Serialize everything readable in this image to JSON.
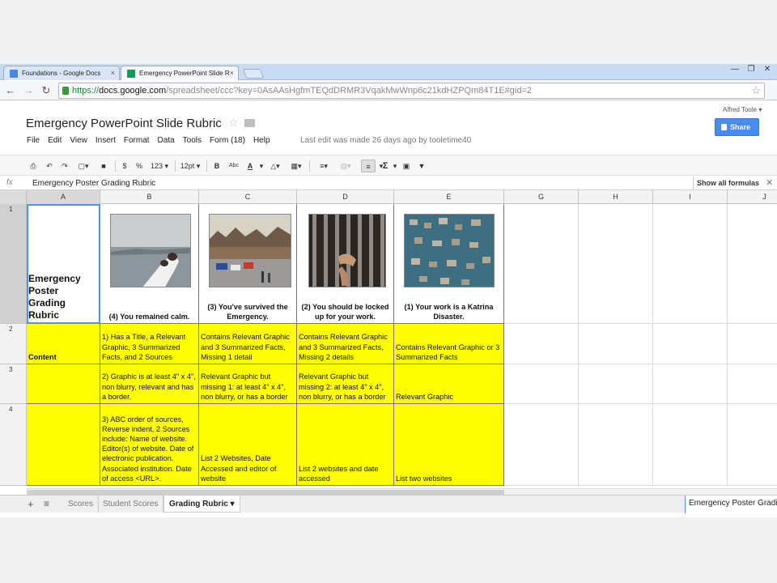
{
  "browser": {
    "tabs": [
      {
        "title": "Foundations - Google Docs",
        "close": "×",
        "icon_color": "#4a86e8"
      },
      {
        "title": "Emergency PowerPoint Slide R",
        "close": "×",
        "icon_color": "#0f9d58"
      }
    ],
    "url": {
      "scheme": "https://",
      "host": "docs.google.com",
      "path": "/spreadsheet/ccc?key=0AsAAsHgfmTEQdDRMR3VqakMwWnp6c21kdHZPQm84T1E#gid=2"
    },
    "window_controls": {
      "minimize": "—",
      "restore": "❐",
      "close": "✕"
    }
  },
  "doc": {
    "title": "Emergency PowerPoint Slide Rubric",
    "user": "Alfred Toole ▾",
    "share_label": "Share",
    "menu": [
      "File",
      "Edit",
      "View",
      "Insert",
      "Format",
      "Data",
      "Tools",
      "Form (18)",
      "Help"
    ],
    "last_edit": "Last edit was made 26 days ago by tooletime40"
  },
  "toolbar": {
    "currency": "$",
    "percent": "%",
    "number_format": "123 ▾",
    "font_size": "12pt ▾",
    "bold": "B",
    "strikethrough": "Abc",
    "text_color": "A",
    "sum": "Σ"
  },
  "formula_bar": {
    "fx": "fx",
    "content": "Emergency Poster Grading Rubric",
    "show_formulas": "Show all formulas",
    "close": "✕"
  },
  "grid": {
    "columns": [
      "A",
      "B",
      "C",
      "D",
      "E",
      "G",
      "H",
      "I",
      "J"
    ],
    "rows": [
      "1",
      "2",
      "3",
      "4"
    ],
    "header": {
      "a1": "Emergency Poster Grading Rubric",
      "b1": "(4) You remained calm.",
      "c1": "(3) You've survived the Emergency.",
      "d1": "(2) You should be locked up for your work.",
      "e1": "(1) Your work is a Katrina Disaster."
    },
    "row2": {
      "a": "Content",
      "b": "1) Has a Title, a Relevant Graphic, 3 Summarized Facts, and 2 Sources",
      "c": "Contains Relevant Graphic and 3 Summarized Facts, Missing 1 detail",
      "d": "Contains Relevant Graphic and 3 Summarized Facts, Missing 2 details",
      "e": "Contains Relevant Graphic or 3 Summarized Facts"
    },
    "row3": {
      "a": "",
      "b": "2) Graphic is at least 4\" x 4\", non blurry, relevant and has a border.",
      "c": "Relevant Graphic but missing 1: at least 4\" x 4\", non blurry, or has a border",
      "d": "Relevant Graphic but missing 2: at least 4\" x 4\", non blurry, or has a border",
      "e": "Relevant Graphic"
    },
    "row4": {
      "a": "",
      "b": "3) ABC order of sources, Reverse indent, 2 Sources include: Name of website. Editor(s) of website. Date of electronic publication. Associated institution. Date of access <URL>.",
      "c": "List 2 Websites, Date Accessed and editor of website",
      "d": "List 2 websites and date accessed",
      "e": "List two websites"
    },
    "cell_highlight_color": "#ffff00"
  },
  "sheets": {
    "add": "+",
    "list": "≡",
    "tabs": [
      "Scores",
      "Student Scores",
      "Grading Rubric ▾"
    ],
    "summary": "Emergency Poster Grading Rubric"
  }
}
